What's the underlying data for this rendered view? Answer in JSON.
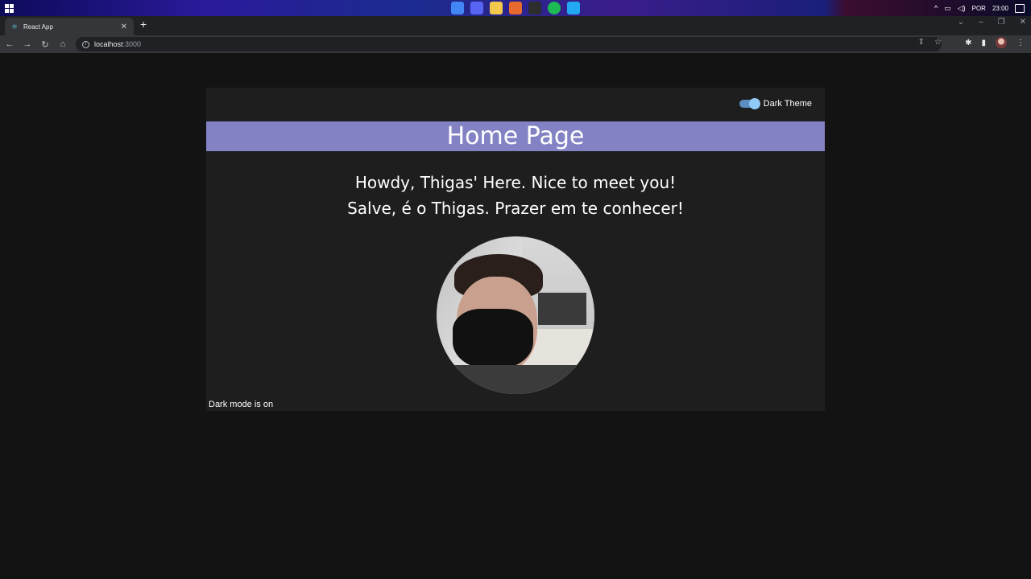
{
  "taskbar": {
    "tray": {
      "language": "POR",
      "time": "23:00"
    }
  },
  "browser": {
    "tab": {
      "title": "React App"
    },
    "address": {
      "host": "localhost",
      "port": ":3000"
    }
  },
  "app": {
    "theme_toggle": {
      "label": "Dark Theme",
      "checked": true
    },
    "header": {
      "title": "Home Page"
    },
    "greeting": {
      "line1": "Howdy, Thigas' Here. Nice to meet you!",
      "line2": "Salve, é o Thigas. Prazer em te conhecer!"
    },
    "status": "Dark mode is on"
  },
  "colors": {
    "header_bar": "#8382c4",
    "app_background": "#1e1e1e",
    "page_background": "#131313",
    "toggle_track": "#5a8ebd",
    "toggle_thumb": "#90caf9"
  }
}
